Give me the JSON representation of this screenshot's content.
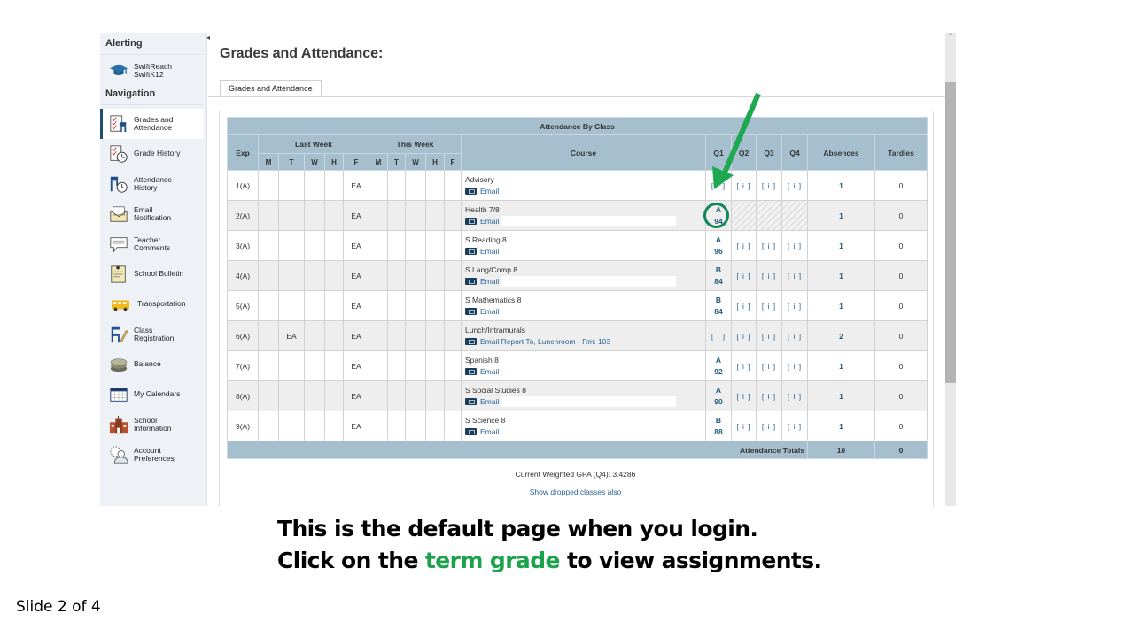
{
  "sidebar": {
    "alerting_heading": "Alerting",
    "alerting_items": [
      {
        "label": "SwiftReach\nSwiftK12",
        "icon": "graduation-cap-icon"
      }
    ],
    "navigation_heading": "Navigation",
    "items": [
      {
        "label": "Grades and\nAttendance",
        "icon": "grades-attendance-icon",
        "active": true
      },
      {
        "label": "Grade History",
        "icon": "grade-history-icon"
      },
      {
        "label": "Attendance\nHistory",
        "icon": "attendance-history-icon"
      },
      {
        "label": "Email\nNotification",
        "icon": "email-envelope-icon"
      },
      {
        "label": "Teacher\nComments",
        "icon": "comment-bubble-icon"
      },
      {
        "label": "School Bulletin",
        "icon": "bulletin-icon"
      },
      {
        "label": "Transportation",
        "icon": "school-bus-icon"
      },
      {
        "label": "Class\nRegistration",
        "icon": "chair-pencil-icon"
      },
      {
        "label": "Balance",
        "icon": "coins-icon"
      },
      {
        "label": "My Calendars",
        "icon": "calendar-icon"
      },
      {
        "label": "School\nInformation",
        "icon": "school-building-icon"
      },
      {
        "label": "Account\nPreferences",
        "icon": "account-gear-icon"
      }
    ],
    "collapse_glyph": "◂"
  },
  "page": {
    "title": "Grades and Attendance:",
    "tab_label": "Grades and Attendance"
  },
  "table": {
    "title": "Attendance By Class",
    "headers": {
      "exp": "Exp",
      "last_week": "Last Week",
      "this_week": "This Week",
      "days": [
        "M",
        "T",
        "W",
        "H",
        "F"
      ],
      "course": "Course",
      "q1": "Q1",
      "q2": "Q2",
      "q3": "Q3",
      "q4": "Q4",
      "absences": "Absences",
      "tardies": "Tardies"
    },
    "rows": [
      {
        "exp": "1(A)",
        "last_week": [
          "",
          "",
          "",
          "",
          "EA"
        ],
        "this_week": [
          "",
          "",
          "",
          "",
          "."
        ],
        "course": "Advisory",
        "email": "Email",
        "redacted": false,
        "q1": {
          "letter": "",
          "pct": "",
          "info": "[ i ]"
        },
        "q2": "[ i ]",
        "q3": "[ i ]",
        "q4": "[ i ]",
        "absences": "1",
        "tardies": "0"
      },
      {
        "exp": "2(A)",
        "last_week": [
          "",
          "",
          "",
          "",
          "EA"
        ],
        "this_week": [
          "",
          "",
          "",
          "",
          ""
        ],
        "course": "Health 7/8",
        "email": "Email",
        "redacted": true,
        "q1": {
          "letter": "A",
          "pct": "94"
        },
        "q2": "",
        "q3": "",
        "q4": "",
        "hatched": true,
        "absences": "1",
        "tardies": "0"
      },
      {
        "exp": "3(A)",
        "last_week": [
          "",
          "",
          "",
          "",
          "EA"
        ],
        "this_week": [
          "",
          "",
          "",
          "",
          ""
        ],
        "course": "S Reading 8",
        "email": "Email",
        "redacted": false,
        "q1": {
          "letter": "A",
          "pct": "96"
        },
        "q2": "[ i ]",
        "q3": "[ i ]",
        "q4": "[ i ]",
        "absences": "1",
        "tardies": "0"
      },
      {
        "exp": "4(A)",
        "last_week": [
          "",
          "",
          "",
          "",
          "EA"
        ],
        "this_week": [
          "",
          "",
          "",
          "",
          ""
        ],
        "course": "S Lang/Comp 8",
        "email": "Email",
        "redacted": true,
        "q1": {
          "letter": "B",
          "pct": "84"
        },
        "q2": "[ i ]",
        "q3": "[ i ]",
        "q4": "[ i ]",
        "absences": "1",
        "tardies": "0"
      },
      {
        "exp": "5(A)",
        "last_week": [
          "",
          "",
          "",
          "",
          "EA"
        ],
        "this_week": [
          "",
          "",
          "",
          "",
          ""
        ],
        "course": "S Mathematics 8",
        "email": "Email",
        "redacted": false,
        "q1": {
          "letter": "B",
          "pct": "84"
        },
        "q2": "[ i ]",
        "q3": "[ i ]",
        "q4": "[ i ]",
        "absences": "1",
        "tardies": "0"
      },
      {
        "exp": "6(A)",
        "last_week": [
          "",
          "EA",
          "",
          "",
          "EA"
        ],
        "this_week": [
          "",
          "",
          "",
          "",
          ""
        ],
        "course": "Lunch/Intramurals",
        "email": "Email Report To, Lunchroom - Rm: 103",
        "redacted": false,
        "q1": {
          "letter": "",
          "pct": "",
          "info": "[ i ]"
        },
        "q2": "[ i ]",
        "q3": "[ i ]",
        "q4": "[ i ]",
        "absences": "2",
        "tardies": "0"
      },
      {
        "exp": "7(A)",
        "last_week": [
          "",
          "",
          "",
          "",
          "EA"
        ],
        "this_week": [
          "",
          "",
          "",
          "",
          ""
        ],
        "course": "Spanish 8",
        "email": "Email",
        "redacted": false,
        "q1": {
          "letter": "A",
          "pct": "92"
        },
        "q2": "[ i ]",
        "q3": "[ i ]",
        "q4": "[ i ]",
        "absences": "1",
        "tardies": "0"
      },
      {
        "exp": "8(A)",
        "last_week": [
          "",
          "",
          "",
          "",
          "EA"
        ],
        "this_week": [
          "",
          "",
          "",
          "",
          ""
        ],
        "course": "S Social Studies 8",
        "email": "Email",
        "redacted": true,
        "q1": {
          "letter": "A",
          "pct": "90"
        },
        "q2": "[ i ]",
        "q3": "[ i ]",
        "q4": "[ i ]",
        "absences": "1",
        "tardies": "0"
      },
      {
        "exp": "9(A)",
        "last_week": [
          "",
          "",
          "",
          "",
          "EA"
        ],
        "this_week": [
          "",
          "",
          "",
          "",
          ""
        ],
        "course": "S Science 8",
        "email": "Email",
        "redacted": false,
        "q1": {
          "letter": "B",
          "pct": "88"
        },
        "q2": "[ i ]",
        "q3": "[ i ]",
        "q4": "[ i ]",
        "absences": "1",
        "tardies": "0"
      }
    ],
    "totals": {
      "label": "Attendance Totals",
      "absences": "10",
      "tardies": "0"
    }
  },
  "footer": {
    "gpa": "Current Weighted GPA (Q4): 3.4286",
    "dropped_link": "Show dropped classes also"
  },
  "scrollbar": {
    "up_glyph": "^"
  },
  "slide": {
    "caption_line1": "This is the default page when you login.",
    "caption_line2_before": "Click on the ",
    "caption_line2_highlight": "term grade",
    "caption_line2_after": " to view assignments.",
    "highlight_color": "#1aa34a",
    "annotation_color": "#11865a",
    "slide_number": "Slide 2 of 4"
  }
}
